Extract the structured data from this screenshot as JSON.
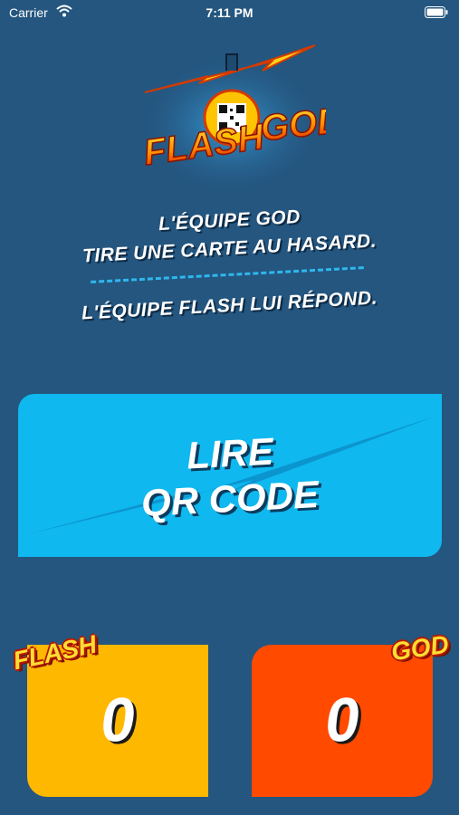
{
  "status_bar": {
    "carrier": "Carrier",
    "time": "7:11 PM"
  },
  "logo": {
    "left_word": "FLASH",
    "right_word": "GOD"
  },
  "instructions": {
    "line1": "L'ÉQUIPE GOD",
    "line2": "TIRE UNE CARTE AU HASARD.",
    "line3": "L'ÉQUIPE FLASH LUI RÉPOND."
  },
  "scan_button": {
    "line1": "LIRE",
    "line2": "QR CODE"
  },
  "scores": {
    "flash": {
      "label": "FLASH",
      "value": "0"
    },
    "god": {
      "label": "GOD",
      "value": "0"
    }
  },
  "colors": {
    "background": "#24567f",
    "scan_button": "#0fb8ef",
    "flash_box": "#ffb800",
    "god_box": "#ff4a00",
    "divider": "#2fb7ee"
  }
}
